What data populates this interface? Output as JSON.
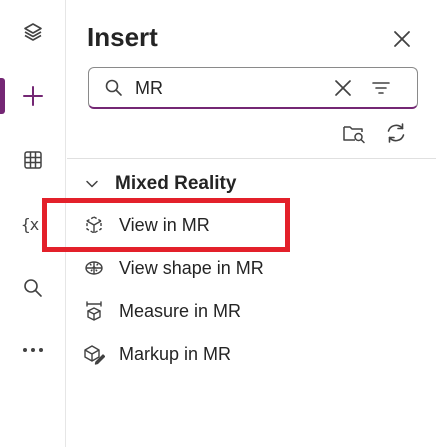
{
  "rail": {
    "items": [
      {
        "name": "layers",
        "icon": "layers-icon"
      },
      {
        "name": "insert",
        "icon": "plus-icon",
        "active": true
      },
      {
        "name": "data",
        "icon": "table-icon"
      },
      {
        "name": "variables",
        "icon": "variables-icon",
        "text": "{x"
      },
      {
        "name": "search",
        "icon": "search-icon"
      },
      {
        "name": "more",
        "icon": "more-icon",
        "text": "···"
      }
    ]
  },
  "panel": {
    "title": "Insert",
    "search": {
      "value": "MR",
      "placeholder": "Search"
    },
    "group": {
      "label": "Mixed Reality",
      "expanded": true
    },
    "items": [
      {
        "label": "View in MR",
        "icon": "view-in-mr-icon"
      },
      {
        "label": "View shape in MR",
        "icon": "view-shape-in-mr-icon"
      },
      {
        "label": "Measure in MR",
        "icon": "measure-in-mr-icon"
      },
      {
        "label": "Markup in MR",
        "icon": "markup-in-mr-icon"
      }
    ]
  },
  "colors": {
    "accent": "#742774",
    "highlight": "#e3202a",
    "text": "#242424",
    "icon": "#424242"
  }
}
